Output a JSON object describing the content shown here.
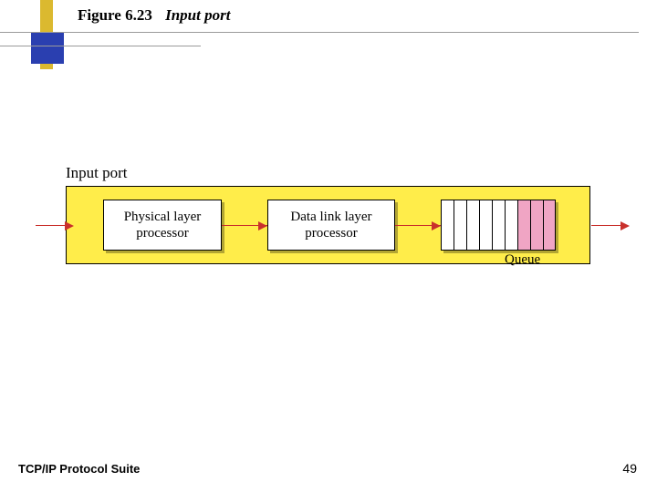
{
  "title": {
    "fig_number": "Figure 6.23",
    "caption": "Input port"
  },
  "diagram": {
    "panel_label": "Input port",
    "box1": "Physical layer\nprocessor",
    "box2": "Data link layer\nprocessor",
    "queue_label": "Queue"
  },
  "footer": {
    "left": "TCP/IP Protocol Suite",
    "page": "49"
  }
}
